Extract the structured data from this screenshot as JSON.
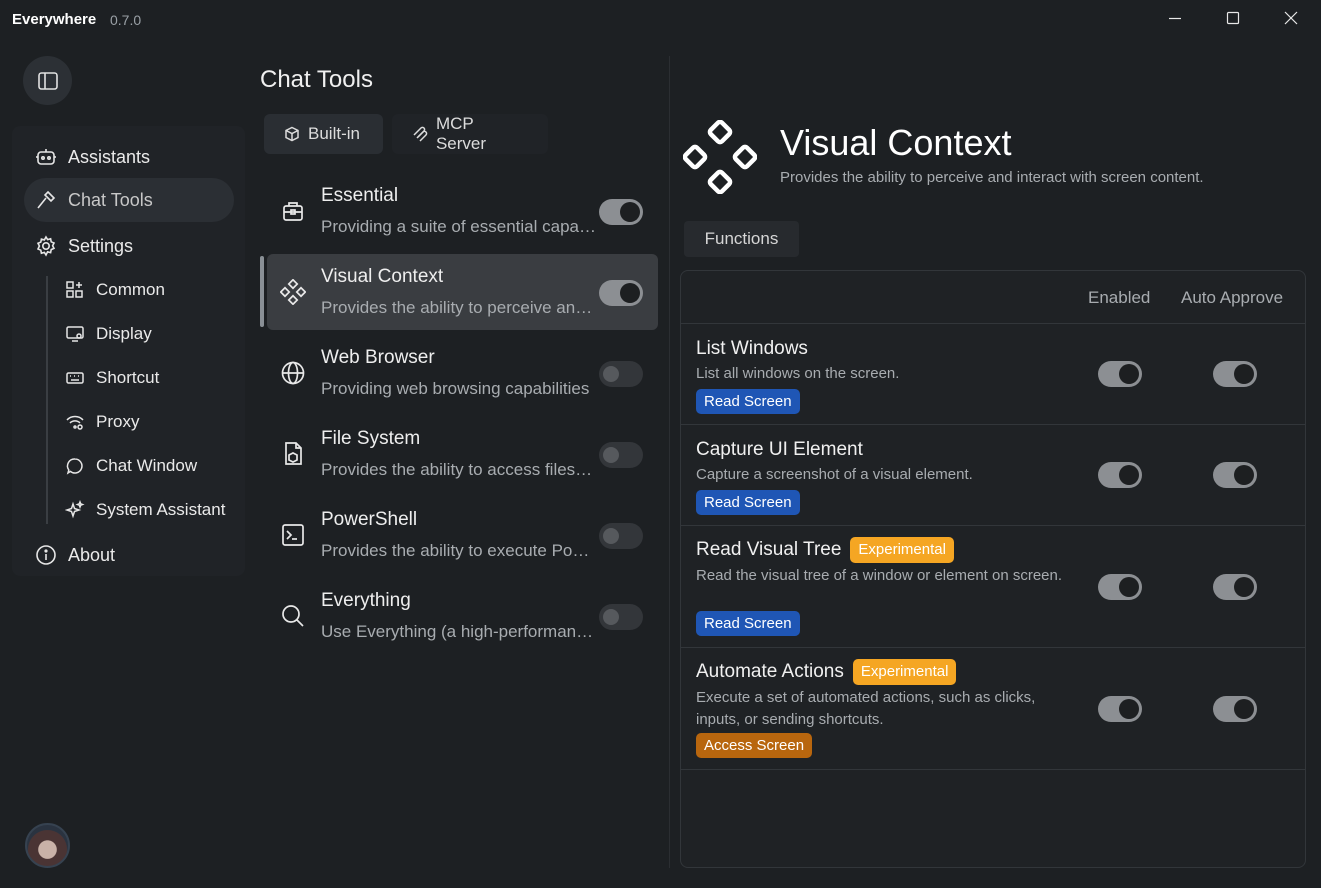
{
  "app": {
    "title": "Everywhere",
    "version": "0.7.0"
  },
  "window_controls": {
    "minimize_icon": "minimize-icon",
    "maximize_icon": "maximize-icon",
    "close_icon": "close-icon"
  },
  "sidebar": {
    "toggle_icon": "sidebar-toggle-icon",
    "items": [
      {
        "label": "Assistants",
        "icon": "robot-icon"
      },
      {
        "label": "Chat Tools",
        "icon": "hammer-icon",
        "active": true
      },
      {
        "label": "Settings",
        "icon": "gear-icon"
      }
    ],
    "subitems": [
      {
        "label": "Common",
        "icon": "grid-plus-icon"
      },
      {
        "label": "Display",
        "icon": "monitor-settings-icon"
      },
      {
        "label": "Shortcut",
        "icon": "keyboard-icon"
      },
      {
        "label": "Proxy",
        "icon": "wifi-settings-icon"
      },
      {
        "label": "Chat Window",
        "icon": "chat-bubble-icon"
      },
      {
        "label": "System Assistant",
        "icon": "sparkles-icon"
      }
    ],
    "about": {
      "label": "About",
      "icon": "info-icon"
    }
  },
  "tools_panel": {
    "title": "Chat Tools",
    "tabs": [
      {
        "label": "Built-in",
        "icon": "cube-icon"
      },
      {
        "label": "MCP Server",
        "icon": "mcp-icon"
      }
    ],
    "tools": [
      {
        "name": "Essential",
        "desc": "Providing a suite of essential capabilities",
        "icon": "toolbox-icon",
        "enabled": true
      },
      {
        "name": "Visual Context",
        "desc": "Provides the ability to perceive and interact with screen content.",
        "icon": "diamonds-icon",
        "enabled": true,
        "selected": true
      },
      {
        "name": "Web Browser",
        "desc": "Providing web browsing capabilities",
        "icon": "globe-icon",
        "enabled": false
      },
      {
        "name": "File System",
        "desc": "Provides the ability to access files, directories",
        "icon": "file-box-icon",
        "enabled": false
      },
      {
        "name": "PowerShell",
        "desc": "Provides the ability to execute PowerShell scripts",
        "icon": "terminal-icon",
        "enabled": false
      },
      {
        "name": "Everything",
        "desc": "Use Everything (a high-performance file search tool)",
        "icon": "search-icon",
        "enabled": false
      }
    ]
  },
  "detail": {
    "title": "Visual Context",
    "subtitle": "Provides the ability to perceive and interact with screen content.",
    "icon": "diamonds-icon",
    "functions_tab": "Functions",
    "columns": {
      "enabled": "Enabled",
      "auto_approve": "Auto Approve"
    },
    "functions": [
      {
        "name": "List Windows",
        "desc": "List all windows on the screen.",
        "permission": "Read Screen",
        "enabled": true,
        "auto_approve": true
      },
      {
        "name": "Capture UI Element",
        "desc": "Capture a screenshot of a visual element.",
        "permission": "Read Screen",
        "enabled": true,
        "auto_approve": true
      },
      {
        "name": "Read Visual Tree",
        "badge": "Experimental",
        "desc": "Read the visual tree of a window or element on screen.",
        "permission": "Read Screen",
        "enabled": true,
        "auto_approve": true
      },
      {
        "name": "Automate Actions",
        "badge": "Experimental",
        "desc": "Execute a set of automated actions, such as clicks, inputs, or sending shortcuts.",
        "permission": "Access Screen",
        "enabled": true,
        "auto_approve": true
      }
    ]
  }
}
